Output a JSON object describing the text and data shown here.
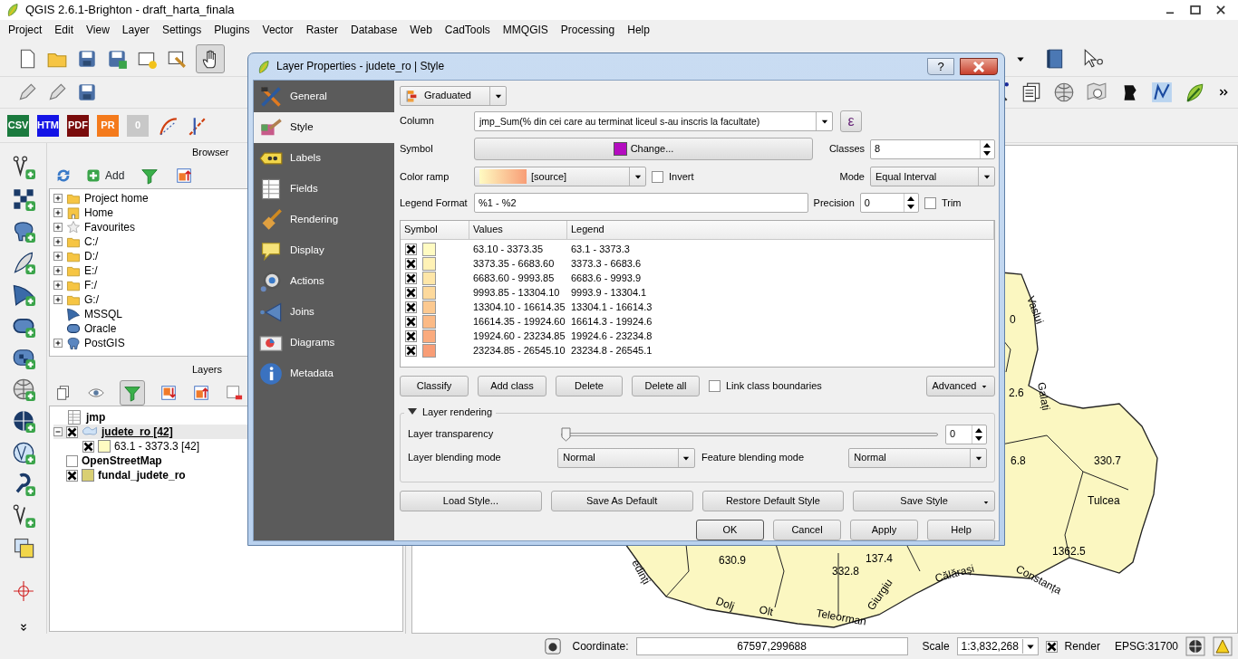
{
  "window": {
    "title": "QGIS 2.6.1-Brighton - draft_harta_finala"
  },
  "menu": [
    "Project",
    "Edit",
    "View",
    "Layer",
    "Settings",
    "Plugins",
    "Vector",
    "Raster",
    "Database",
    "Web",
    "CadTools",
    "MMQGIS",
    "Processing",
    "Help"
  ],
  "toolbar_badges": [
    {
      "label": "CSV",
      "color": "#1b7a3e"
    },
    {
      "label": "HTM",
      "color": "#1414e6"
    },
    {
      "label": "PDF",
      "color": "#7a0c0c"
    },
    {
      "label": "PR",
      "color": "#f47a1c"
    },
    {
      "label": "0",
      "color": "#c8c8c8"
    }
  ],
  "browser": {
    "title": "Browser",
    "add_button": "Add",
    "items": [
      {
        "label": "Project home",
        "expandable": true
      },
      {
        "label": "Home",
        "expandable": true
      },
      {
        "label": "Favourites",
        "expandable": true
      },
      {
        "label": "C:/",
        "expandable": true
      },
      {
        "label": "D:/",
        "expandable": true
      },
      {
        "label": "E:/",
        "expandable": true
      },
      {
        "label": "F:/",
        "expandable": true
      },
      {
        "label": "G:/",
        "expandable": true
      },
      {
        "label": "MSSQL",
        "expandable": false
      },
      {
        "label": "Oracle",
        "expandable": false
      },
      {
        "label": "PostGIS",
        "expandable": true
      }
    ]
  },
  "layers": {
    "title": "Layers",
    "items": [
      {
        "label": "jmp",
        "kind": "table",
        "selected": false
      },
      {
        "label": "judete_ro [42]",
        "kind": "vector",
        "checked": true,
        "selected": true,
        "expanded": true,
        "children": [
          {
            "label": "63.1 - 3373.3 [42]",
            "checked": true,
            "color": "#fffbc2"
          }
        ]
      },
      {
        "label": "OpenStreetMap",
        "kind": "plain",
        "checked": false,
        "selected": false
      },
      {
        "label": "fundal_judete_ro",
        "kind": "fill",
        "checked": true,
        "selected": false,
        "color": "#d9cf73"
      }
    ]
  },
  "map": {
    "labels": [
      "Vaslui",
      "0",
      "2.6",
      "Galați",
      "6.8",
      "330.7",
      "Tulcea",
      "1362.5",
      "Constanța",
      "Călărași",
      "Giurgiu",
      "137.4",
      "332.8",
      "Teleorman",
      "Olt",
      "Dolj",
      "630.9",
      "edinți"
    ]
  },
  "status_bar": {
    "coordinate_label": "Coordinate:",
    "coordinate": "67597,299688",
    "scale_label": "Scale",
    "scale": "1:3,832,268",
    "render_label": "Render",
    "render": true,
    "crs": "EPSG:31700"
  },
  "dialog": {
    "title": "Layer Properties - judete_ro | Style",
    "help_button": "?",
    "sidebar": [
      {
        "label": "General",
        "selected": false
      },
      {
        "label": "Style",
        "selected": true
      },
      {
        "label": "Labels",
        "selected": false
      },
      {
        "label": "Fields",
        "selected": false
      },
      {
        "label": "Rendering",
        "selected": false
      },
      {
        "label": "Display",
        "selected": false
      },
      {
        "label": "Actions",
        "selected": false
      },
      {
        "label": "Joins",
        "selected": false
      },
      {
        "label": "Diagrams",
        "selected": false
      },
      {
        "label": "Metadata",
        "selected": false
      }
    ],
    "renderer": "Graduated",
    "column_label": "Column",
    "column": "jmp_Sum(% din cei care au terminat liceul s-au inscris la facultate)",
    "expression_button": "ε",
    "symbol_label": "Symbol",
    "symbol_button": "Change...",
    "classes_label": "Classes",
    "classes": "8",
    "color_ramp_label": "Color ramp",
    "color_ramp": "[source]",
    "invert_label": "Invert",
    "invert": false,
    "mode_label": "Mode",
    "mode": "Equal Interval",
    "legend_format_label": "Legend Format",
    "legend_format": "%1 - %2",
    "precision_label": "Precision",
    "precision": "0",
    "trim_label": "Trim",
    "trim": false,
    "table": {
      "columns": [
        "Symbol",
        "Values",
        "Legend"
      ],
      "rows": [
        {
          "checked": true,
          "color": "#fffbc2",
          "values": "63.10 - 3373.35",
          "legend": "63.1 - 3373.3"
        },
        {
          "checked": true,
          "color": "#fff2b6",
          "values": "3373.35 - 6683.60",
          "legend": "3373.3 - 6683.6"
        },
        {
          "checked": true,
          "color": "#fee6a8",
          "values": "6683.60 - 9993.85",
          "legend": "6683.6 - 9993.9"
        },
        {
          "checked": true,
          "color": "#fdd99c",
          "values": "9993.85 - 13304.10",
          "legend": "9993.9 - 13304.1"
        },
        {
          "checked": true,
          "color": "#fcc990",
          "values": "13304.10 - 16614.35",
          "legend": "13304.1 - 16614.3"
        },
        {
          "checked": true,
          "color": "#fbba86",
          "values": "16614.35 - 19924.60",
          "legend": "16614.3 - 19924.6"
        },
        {
          "checked": true,
          "color": "#faab7e",
          "values": "19924.60 - 23234.85",
          "legend": "19924.6 - 23234.8"
        },
        {
          "checked": true,
          "color": "#f89d76",
          "values": "23234.85 - 26545.10",
          "legend": "23234.8 - 26545.1"
        }
      ]
    },
    "class_buttons": [
      "Classify",
      "Add class",
      "Delete",
      "Delete all"
    ],
    "link_boundaries": {
      "label": "Link class boundaries",
      "checked": false
    },
    "advanced_button": "Advanced",
    "layer_rendering": {
      "title": "Layer rendering",
      "expanded": true,
      "transparency_label": "Layer transparency",
      "transparency": {
        "level": 0,
        "value": "0"
      },
      "layer_blending_label": "Layer blending mode",
      "layer_blending": "Normal",
      "feature_blending_label": "Feature blending mode",
      "feature_blending": "Normal"
    },
    "style_buttons": [
      {
        "label": "Load Style...",
        "menu": false
      },
      {
        "label": "Save As Default",
        "menu": false
      },
      {
        "label": "Restore Default Style",
        "menu": false
      },
      {
        "label": "Save Style",
        "menu": true
      }
    ],
    "dialog_buttons": [
      {
        "label": "OK",
        "default": true
      },
      {
        "label": "Cancel",
        "default": false
      },
      {
        "label": "Apply",
        "default": false
      },
      {
        "label": "Help",
        "default": false
      }
    ]
  }
}
